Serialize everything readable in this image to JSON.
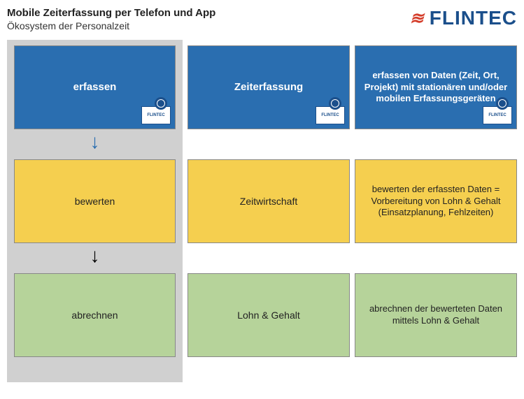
{
  "header": {
    "title": "Mobile Zeiterfassung per Telefon und App",
    "subtitle": "Ökosystem der Personalzeit"
  },
  "brand": {
    "name": "FLINTEC",
    "badge_text": "FLINTEC"
  },
  "rows": [
    {
      "color": "blue",
      "process": "erfassen",
      "category": "Zeiterfassung",
      "description": "erfassen von Daten (Zeit, Ort, Projekt) mit stationären und/oder mobilen Erfassungsgeräten",
      "badge": true
    },
    {
      "color": "yellow",
      "process": "bewerten",
      "category": "Zeitwirtschaft",
      "description": "bewerten der erfassten Daten = Vorbereitung von Lohn & Gehalt (Einsatzplanung, Fehlzeiten)",
      "badge": false
    },
    {
      "color": "green",
      "process": "abrechnen",
      "category": "Lohn & Gehalt",
      "description": "abrechnen der bewerteten Daten mittels Lohn & Gehalt",
      "badge": false
    }
  ],
  "arrows": [
    {
      "after_row": 0,
      "style": "blue"
    },
    {
      "after_row": 1,
      "style": "black"
    }
  ]
}
